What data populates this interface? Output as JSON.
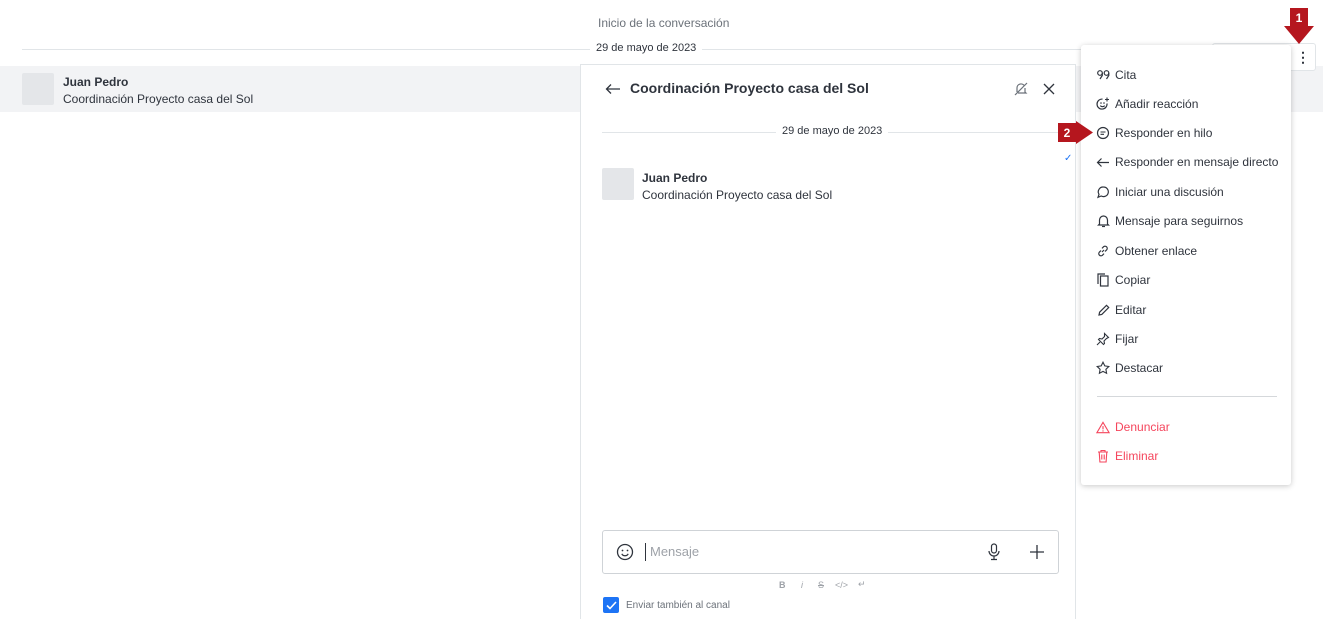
{
  "conversation": {
    "start_label": "Inicio de la conversación",
    "date_label": "29 de mayo de 2023",
    "message": {
      "author": "Juan Pedro",
      "text": "Coordinación Proyecto casa del Sol"
    }
  },
  "thread": {
    "title": "Coordinación Proyecto casa del Sol",
    "date_label": "29 de mayo de 2023",
    "message": {
      "author": "Juan Pedro",
      "text": "Coordinación Proyecto casa del Sol"
    },
    "composer": {
      "placeholder": "Mensaje",
      "formatting": [
        "B",
        "i",
        "S",
        "</>",
        "↵"
      ]
    },
    "also_send_to_channel": {
      "label": "Enviar también al canal",
      "checked": true
    }
  },
  "menu": {
    "items": [
      {
        "label": "Cita",
        "icon": "quote-icon"
      },
      {
        "label": "Añadir reacción",
        "icon": "add-reaction-icon"
      },
      {
        "label": "Responder en hilo",
        "icon": "thread-icon"
      },
      {
        "label": "Responder en mensaje directo",
        "icon": "reply-direct-icon"
      },
      {
        "label": "Iniciar una discusión",
        "icon": "discussion-icon"
      },
      {
        "label": "Mensaje para seguirnos",
        "icon": "bell-icon"
      },
      {
        "label": "Obtener enlace",
        "icon": "link-icon"
      },
      {
        "label": "Copiar",
        "icon": "copy-icon"
      },
      {
        "label": "Editar",
        "icon": "pencil-icon"
      },
      {
        "label": "Fijar",
        "icon": "pin-icon"
      },
      {
        "label": "Destacar",
        "icon": "star-icon"
      }
    ],
    "danger_items": [
      {
        "label": "Denunciar",
        "icon": "warning-icon"
      },
      {
        "label": "Eliminar",
        "icon": "trash-icon"
      }
    ]
  },
  "annotations": {
    "step1": "1",
    "step2": "2"
  },
  "colors": {
    "accent": "#1d74f5",
    "danger": "#f5455c",
    "annotation": "#b5161e",
    "row_highlight": "#f2f3f5"
  }
}
